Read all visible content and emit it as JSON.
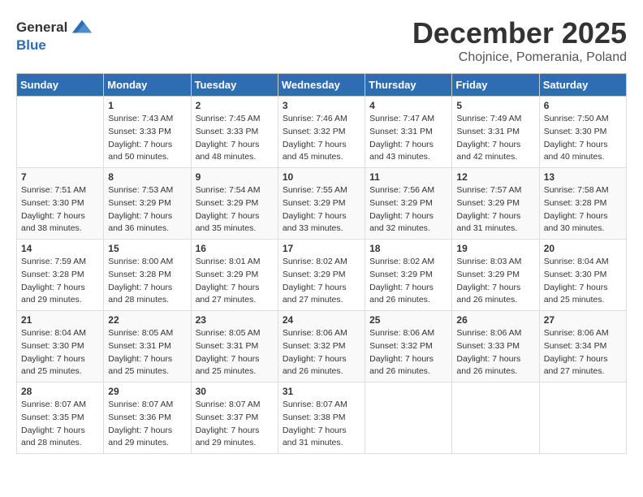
{
  "header": {
    "logo_line1": "General",
    "logo_line2": "Blue",
    "month_title": "December 2025",
    "subtitle": "Chojnice, Pomerania, Poland"
  },
  "days_of_week": [
    "Sunday",
    "Monday",
    "Tuesday",
    "Wednesday",
    "Thursday",
    "Friday",
    "Saturday"
  ],
  "weeks": [
    [
      {
        "day": "",
        "info": ""
      },
      {
        "day": "1",
        "info": "Sunrise: 7:43 AM\nSunset: 3:33 PM\nDaylight: 7 hours\nand 50 minutes."
      },
      {
        "day": "2",
        "info": "Sunrise: 7:45 AM\nSunset: 3:33 PM\nDaylight: 7 hours\nand 48 minutes."
      },
      {
        "day": "3",
        "info": "Sunrise: 7:46 AM\nSunset: 3:32 PM\nDaylight: 7 hours\nand 45 minutes."
      },
      {
        "day": "4",
        "info": "Sunrise: 7:47 AM\nSunset: 3:31 PM\nDaylight: 7 hours\nand 43 minutes."
      },
      {
        "day": "5",
        "info": "Sunrise: 7:49 AM\nSunset: 3:31 PM\nDaylight: 7 hours\nand 42 minutes."
      },
      {
        "day": "6",
        "info": "Sunrise: 7:50 AM\nSunset: 3:30 PM\nDaylight: 7 hours\nand 40 minutes."
      }
    ],
    [
      {
        "day": "7",
        "info": "Sunrise: 7:51 AM\nSunset: 3:30 PM\nDaylight: 7 hours\nand 38 minutes."
      },
      {
        "day": "8",
        "info": "Sunrise: 7:53 AM\nSunset: 3:29 PM\nDaylight: 7 hours\nand 36 minutes."
      },
      {
        "day": "9",
        "info": "Sunrise: 7:54 AM\nSunset: 3:29 PM\nDaylight: 7 hours\nand 35 minutes."
      },
      {
        "day": "10",
        "info": "Sunrise: 7:55 AM\nSunset: 3:29 PM\nDaylight: 7 hours\nand 33 minutes."
      },
      {
        "day": "11",
        "info": "Sunrise: 7:56 AM\nSunset: 3:29 PM\nDaylight: 7 hours\nand 32 minutes."
      },
      {
        "day": "12",
        "info": "Sunrise: 7:57 AM\nSunset: 3:29 PM\nDaylight: 7 hours\nand 31 minutes."
      },
      {
        "day": "13",
        "info": "Sunrise: 7:58 AM\nSunset: 3:28 PM\nDaylight: 7 hours\nand 30 minutes."
      }
    ],
    [
      {
        "day": "14",
        "info": "Sunrise: 7:59 AM\nSunset: 3:28 PM\nDaylight: 7 hours\nand 29 minutes."
      },
      {
        "day": "15",
        "info": "Sunrise: 8:00 AM\nSunset: 3:28 PM\nDaylight: 7 hours\nand 28 minutes."
      },
      {
        "day": "16",
        "info": "Sunrise: 8:01 AM\nSunset: 3:29 PM\nDaylight: 7 hours\nand 27 minutes."
      },
      {
        "day": "17",
        "info": "Sunrise: 8:02 AM\nSunset: 3:29 PM\nDaylight: 7 hours\nand 27 minutes."
      },
      {
        "day": "18",
        "info": "Sunrise: 8:02 AM\nSunset: 3:29 PM\nDaylight: 7 hours\nand 26 minutes."
      },
      {
        "day": "19",
        "info": "Sunrise: 8:03 AM\nSunset: 3:29 PM\nDaylight: 7 hours\nand 26 minutes."
      },
      {
        "day": "20",
        "info": "Sunrise: 8:04 AM\nSunset: 3:30 PM\nDaylight: 7 hours\nand 25 minutes."
      }
    ],
    [
      {
        "day": "21",
        "info": "Sunrise: 8:04 AM\nSunset: 3:30 PM\nDaylight: 7 hours\nand 25 minutes."
      },
      {
        "day": "22",
        "info": "Sunrise: 8:05 AM\nSunset: 3:31 PM\nDaylight: 7 hours\nand 25 minutes."
      },
      {
        "day": "23",
        "info": "Sunrise: 8:05 AM\nSunset: 3:31 PM\nDaylight: 7 hours\nand 25 minutes."
      },
      {
        "day": "24",
        "info": "Sunrise: 8:06 AM\nSunset: 3:32 PM\nDaylight: 7 hours\nand 26 minutes."
      },
      {
        "day": "25",
        "info": "Sunrise: 8:06 AM\nSunset: 3:32 PM\nDaylight: 7 hours\nand 26 minutes."
      },
      {
        "day": "26",
        "info": "Sunrise: 8:06 AM\nSunset: 3:33 PM\nDaylight: 7 hours\nand 26 minutes."
      },
      {
        "day": "27",
        "info": "Sunrise: 8:06 AM\nSunset: 3:34 PM\nDaylight: 7 hours\nand 27 minutes."
      }
    ],
    [
      {
        "day": "28",
        "info": "Sunrise: 8:07 AM\nSunset: 3:35 PM\nDaylight: 7 hours\nand 28 minutes."
      },
      {
        "day": "29",
        "info": "Sunrise: 8:07 AM\nSunset: 3:36 PM\nDaylight: 7 hours\nand 29 minutes."
      },
      {
        "day": "30",
        "info": "Sunrise: 8:07 AM\nSunset: 3:37 PM\nDaylight: 7 hours\nand 29 minutes."
      },
      {
        "day": "31",
        "info": "Sunrise: 8:07 AM\nSunset: 3:38 PM\nDaylight: 7 hours\nand 31 minutes."
      },
      {
        "day": "",
        "info": ""
      },
      {
        "day": "",
        "info": ""
      },
      {
        "day": "",
        "info": ""
      }
    ]
  ]
}
